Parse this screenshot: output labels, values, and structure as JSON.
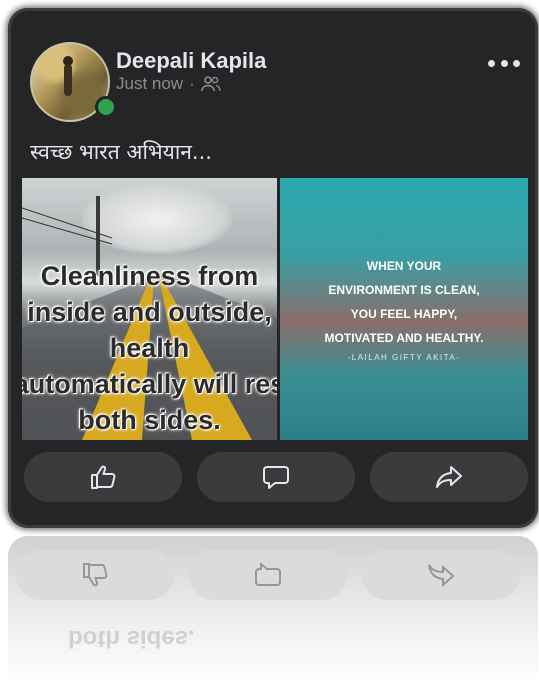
{
  "post": {
    "author": "Deepali Kapila",
    "timestamp": "Just now",
    "separator": "·",
    "audience_icon": "friends-icon",
    "text": "स्वच्छ भारत अभियान..."
  },
  "images": {
    "left_quote_lines": [
      "Cleanliness from",
      "inside and outside,",
      "health",
      "automatically will res",
      "both sides."
    ],
    "right_quote_lines": [
      "WHEN YOUR",
      "ENVIRONMENT IS CLEAN,",
      "YOU FEEL HAPPY,",
      "MOTIVATED AND HEALTHY."
    ],
    "right_author": "-LAILAH GIFTY AKITA-"
  },
  "actions": [
    {
      "name": "like",
      "icon": "thumbs-up-icon"
    },
    {
      "name": "comment",
      "icon": "comment-icon"
    },
    {
      "name": "share",
      "icon": "share-icon"
    }
  ],
  "colors": {
    "card_bg": "#242526",
    "text_primary": "#e4e6eb",
    "text_secondary": "#8a8d91",
    "online": "#31a24c",
    "button_bg": "#3a3b3c"
  }
}
